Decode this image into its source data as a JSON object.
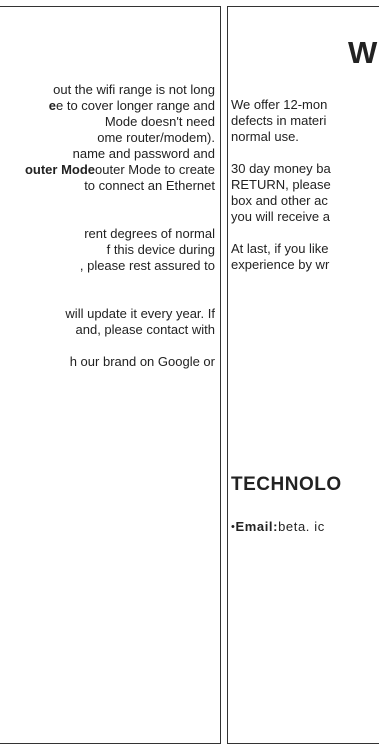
{
  "left": {
    "lines": [
      "out the wifi range is not long",
      "e to cover longer range and",
      "Mode doesn't need",
      "ome router/modem).",
      "name and password and",
      "outer Mode to create",
      "to connect an Ethernet",
      "rent degrees of normal",
      "f this device during",
      ", please rest assured to",
      "will update it every year. If",
      "and, please contact with",
      "h our brand on Google or"
    ],
    "bold_runs": [
      "e",
      "outer Mode"
    ]
  },
  "right": {
    "title": "W",
    "lines": [
      "We offer 12-mon",
      "defects in materi",
      "normal use.",
      "30 day money ba",
      "RETURN, please",
      "box and other ac",
      "you will receive a",
      "At last, if you like",
      "experience by wr"
    ],
    "tech_heading": "TECHNOLO",
    "email_label": "Email:",
    "email_value": "beta. ic",
    "bullet": "•"
  }
}
